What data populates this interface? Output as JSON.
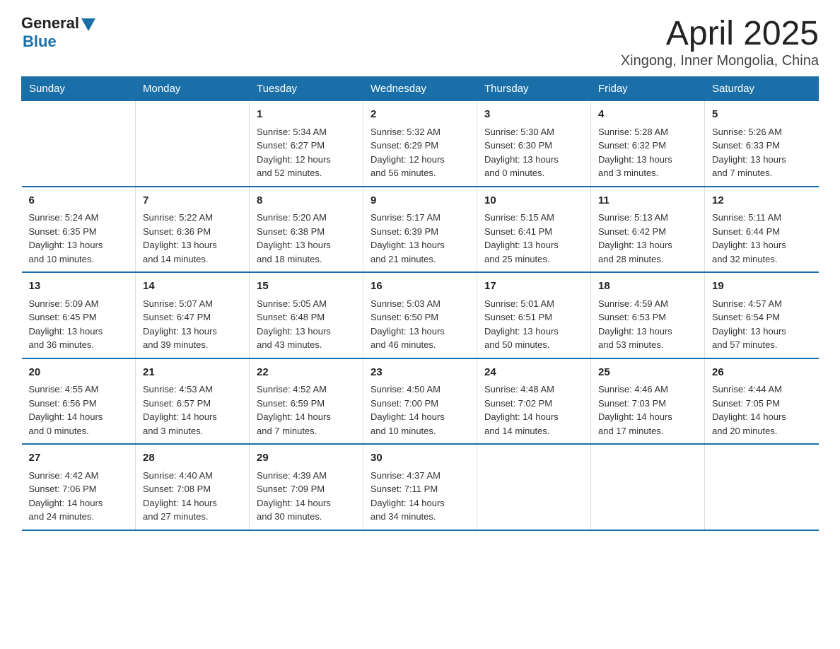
{
  "logo": {
    "general": "General",
    "blue": "Blue"
  },
  "title": "April 2025",
  "subtitle": "Xingong, Inner Mongolia, China",
  "header_days": [
    "Sunday",
    "Monday",
    "Tuesday",
    "Wednesday",
    "Thursday",
    "Friday",
    "Saturday"
  ],
  "weeks": [
    [
      {
        "day": "",
        "info": ""
      },
      {
        "day": "",
        "info": ""
      },
      {
        "day": "1",
        "info": "Sunrise: 5:34 AM\nSunset: 6:27 PM\nDaylight: 12 hours\nand 52 minutes."
      },
      {
        "day": "2",
        "info": "Sunrise: 5:32 AM\nSunset: 6:29 PM\nDaylight: 12 hours\nand 56 minutes."
      },
      {
        "day": "3",
        "info": "Sunrise: 5:30 AM\nSunset: 6:30 PM\nDaylight: 13 hours\nand 0 minutes."
      },
      {
        "day": "4",
        "info": "Sunrise: 5:28 AM\nSunset: 6:32 PM\nDaylight: 13 hours\nand 3 minutes."
      },
      {
        "day": "5",
        "info": "Sunrise: 5:26 AM\nSunset: 6:33 PM\nDaylight: 13 hours\nand 7 minutes."
      }
    ],
    [
      {
        "day": "6",
        "info": "Sunrise: 5:24 AM\nSunset: 6:35 PM\nDaylight: 13 hours\nand 10 minutes."
      },
      {
        "day": "7",
        "info": "Sunrise: 5:22 AM\nSunset: 6:36 PM\nDaylight: 13 hours\nand 14 minutes."
      },
      {
        "day": "8",
        "info": "Sunrise: 5:20 AM\nSunset: 6:38 PM\nDaylight: 13 hours\nand 18 minutes."
      },
      {
        "day": "9",
        "info": "Sunrise: 5:17 AM\nSunset: 6:39 PM\nDaylight: 13 hours\nand 21 minutes."
      },
      {
        "day": "10",
        "info": "Sunrise: 5:15 AM\nSunset: 6:41 PM\nDaylight: 13 hours\nand 25 minutes."
      },
      {
        "day": "11",
        "info": "Sunrise: 5:13 AM\nSunset: 6:42 PM\nDaylight: 13 hours\nand 28 minutes."
      },
      {
        "day": "12",
        "info": "Sunrise: 5:11 AM\nSunset: 6:44 PM\nDaylight: 13 hours\nand 32 minutes."
      }
    ],
    [
      {
        "day": "13",
        "info": "Sunrise: 5:09 AM\nSunset: 6:45 PM\nDaylight: 13 hours\nand 36 minutes."
      },
      {
        "day": "14",
        "info": "Sunrise: 5:07 AM\nSunset: 6:47 PM\nDaylight: 13 hours\nand 39 minutes."
      },
      {
        "day": "15",
        "info": "Sunrise: 5:05 AM\nSunset: 6:48 PM\nDaylight: 13 hours\nand 43 minutes."
      },
      {
        "day": "16",
        "info": "Sunrise: 5:03 AM\nSunset: 6:50 PM\nDaylight: 13 hours\nand 46 minutes."
      },
      {
        "day": "17",
        "info": "Sunrise: 5:01 AM\nSunset: 6:51 PM\nDaylight: 13 hours\nand 50 minutes."
      },
      {
        "day": "18",
        "info": "Sunrise: 4:59 AM\nSunset: 6:53 PM\nDaylight: 13 hours\nand 53 minutes."
      },
      {
        "day": "19",
        "info": "Sunrise: 4:57 AM\nSunset: 6:54 PM\nDaylight: 13 hours\nand 57 minutes."
      }
    ],
    [
      {
        "day": "20",
        "info": "Sunrise: 4:55 AM\nSunset: 6:56 PM\nDaylight: 14 hours\nand 0 minutes."
      },
      {
        "day": "21",
        "info": "Sunrise: 4:53 AM\nSunset: 6:57 PM\nDaylight: 14 hours\nand 3 minutes."
      },
      {
        "day": "22",
        "info": "Sunrise: 4:52 AM\nSunset: 6:59 PM\nDaylight: 14 hours\nand 7 minutes."
      },
      {
        "day": "23",
        "info": "Sunrise: 4:50 AM\nSunset: 7:00 PM\nDaylight: 14 hours\nand 10 minutes."
      },
      {
        "day": "24",
        "info": "Sunrise: 4:48 AM\nSunset: 7:02 PM\nDaylight: 14 hours\nand 14 minutes."
      },
      {
        "day": "25",
        "info": "Sunrise: 4:46 AM\nSunset: 7:03 PM\nDaylight: 14 hours\nand 17 minutes."
      },
      {
        "day": "26",
        "info": "Sunrise: 4:44 AM\nSunset: 7:05 PM\nDaylight: 14 hours\nand 20 minutes."
      }
    ],
    [
      {
        "day": "27",
        "info": "Sunrise: 4:42 AM\nSunset: 7:06 PM\nDaylight: 14 hours\nand 24 minutes."
      },
      {
        "day": "28",
        "info": "Sunrise: 4:40 AM\nSunset: 7:08 PM\nDaylight: 14 hours\nand 27 minutes."
      },
      {
        "day": "29",
        "info": "Sunrise: 4:39 AM\nSunset: 7:09 PM\nDaylight: 14 hours\nand 30 minutes."
      },
      {
        "day": "30",
        "info": "Sunrise: 4:37 AM\nSunset: 7:11 PM\nDaylight: 14 hours\nand 34 minutes."
      },
      {
        "day": "",
        "info": ""
      },
      {
        "day": "",
        "info": ""
      },
      {
        "day": "",
        "info": ""
      }
    ]
  ]
}
